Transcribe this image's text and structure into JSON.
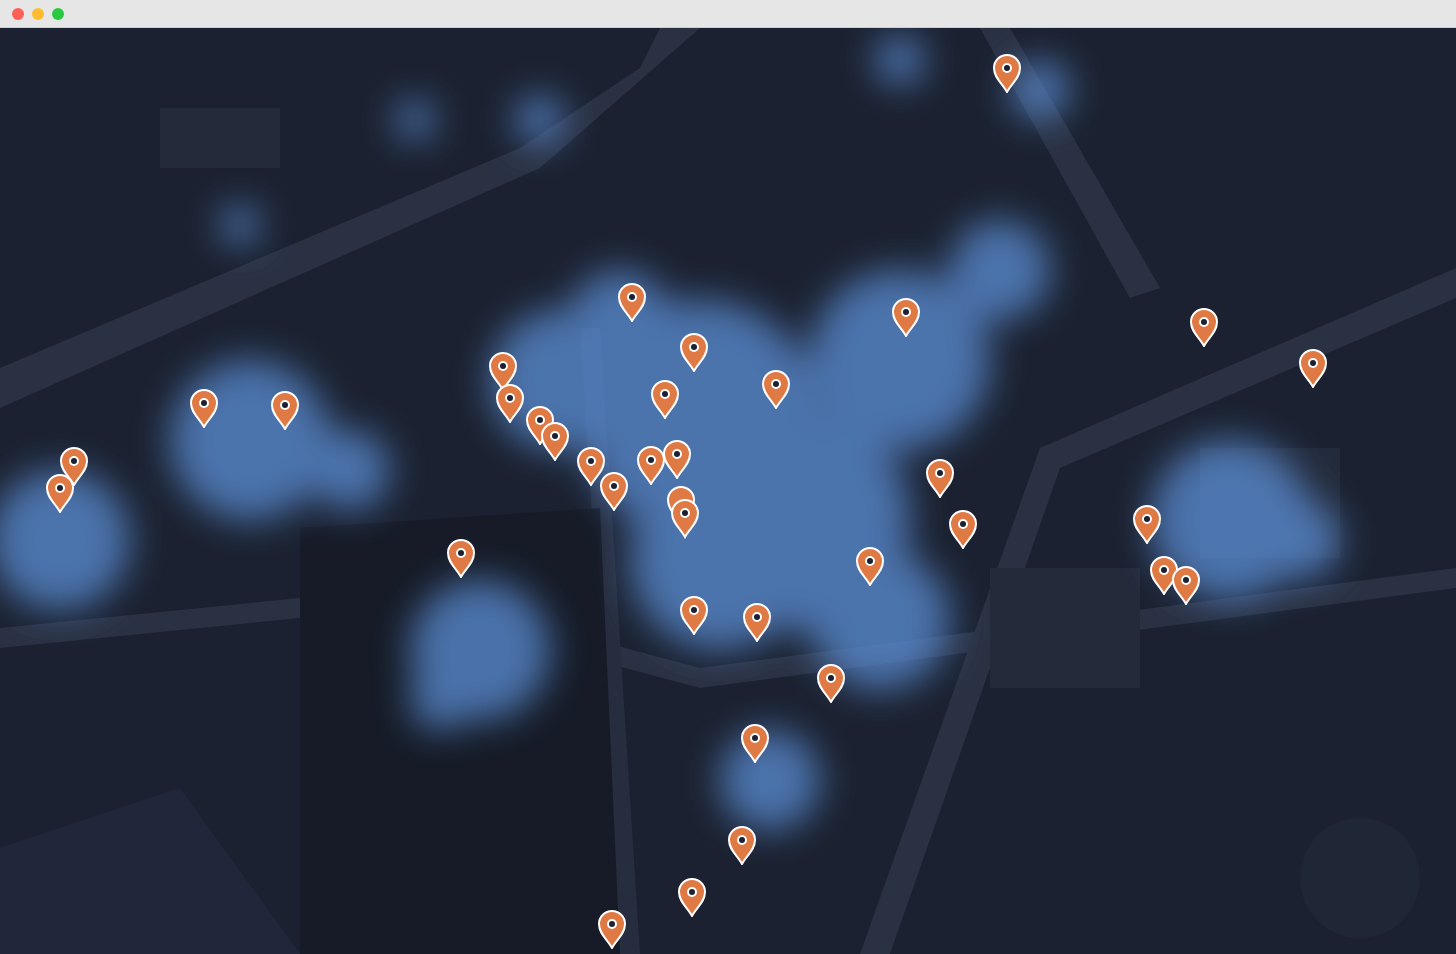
{
  "window": {
    "buttons": [
      {
        "kind": "close"
      },
      {
        "kind": "minimize"
      },
      {
        "kind": "zoom"
      }
    ]
  }
}
